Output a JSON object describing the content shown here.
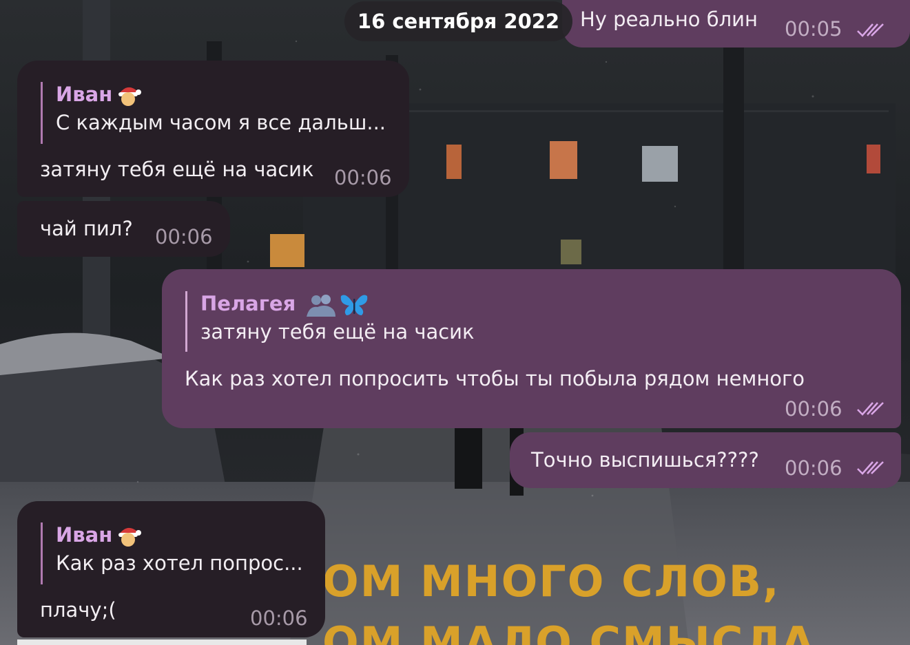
{
  "date_separator": "16 сентября 2022",
  "poster_text": {
    "line1": "ОМ  МНОГО  СЛОВ,",
    "line2": "ОМ  МАЛО  СМЫСЛА"
  },
  "messages": [
    {
      "id": "m1",
      "direction": "outgoing",
      "text": "Ну реально блин",
      "time": "00:05",
      "status": "read"
    },
    {
      "id": "m2",
      "direction": "incoming",
      "reply": {
        "name": "Иван",
        "name_emoji": "santa",
        "text": "С каждым часом я все дальш..."
      },
      "text": "затяну тебя ещё на часик",
      "time": "00:06"
    },
    {
      "id": "m3",
      "direction": "incoming",
      "text": "чай пил?",
      "time": "00:06"
    },
    {
      "id": "m4",
      "direction": "outgoing",
      "reply": {
        "name": "Пелагея",
        "name_emoji": "hug-silhouette butterfly",
        "text": "затяну тебя ещё на часик"
      },
      "text": "Как раз хотел попросить чтобы ты побыла рядом немного",
      "time": "00:06",
      "status": "read"
    },
    {
      "id": "m5",
      "direction": "outgoing",
      "text": "Точно выспишься????",
      "time": "00:06",
      "status": "read"
    },
    {
      "id": "m6",
      "direction": "incoming",
      "reply": {
        "name": "Иван",
        "name_emoji": "santa",
        "text": "Как раз хотел попрос..."
      },
      "text": "плачу;(",
      "time": "00:06"
    }
  ],
  "colors": {
    "incoming_bubble": "#261e26",
    "outgoing_bubble": "#5f3d5f",
    "reply_name": "#d9a6e6",
    "poster_text": "#d9a12a"
  }
}
